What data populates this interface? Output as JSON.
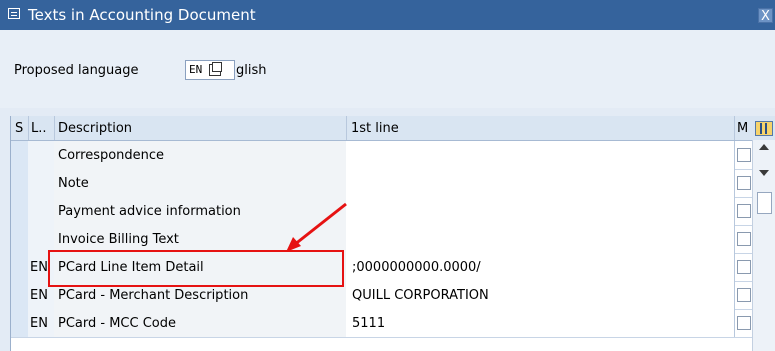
{
  "window": {
    "title": "Texts in Accounting Document",
    "close_label": "X"
  },
  "language": {
    "label": "Proposed language",
    "code": "EN",
    "name": "glish"
  },
  "table": {
    "headers": {
      "sel": "S",
      "lang": "L..",
      "desc": "Description",
      "first": "1st line",
      "m": "M"
    },
    "rows": [
      {
        "lang": "",
        "desc": "Correspondence",
        "first": ""
      },
      {
        "lang": "",
        "desc": "Note",
        "first": ""
      },
      {
        "lang": "",
        "desc": "Payment advice information",
        "first": ""
      },
      {
        "lang": "",
        "desc": "Invoice Billing Text",
        "first": ""
      },
      {
        "lang": "EN",
        "desc": "PCard Line Item Detail",
        "first": ";0000000000.0000/"
      },
      {
        "lang": "EN",
        "desc": "PCard - Merchant Description",
        "first": "QUILL CORPORATION"
      },
      {
        "lang": "EN",
        "desc": "PCard - MCC Code",
        "first": "5111"
      }
    ]
  },
  "annotation": {
    "color": "#e61212"
  }
}
